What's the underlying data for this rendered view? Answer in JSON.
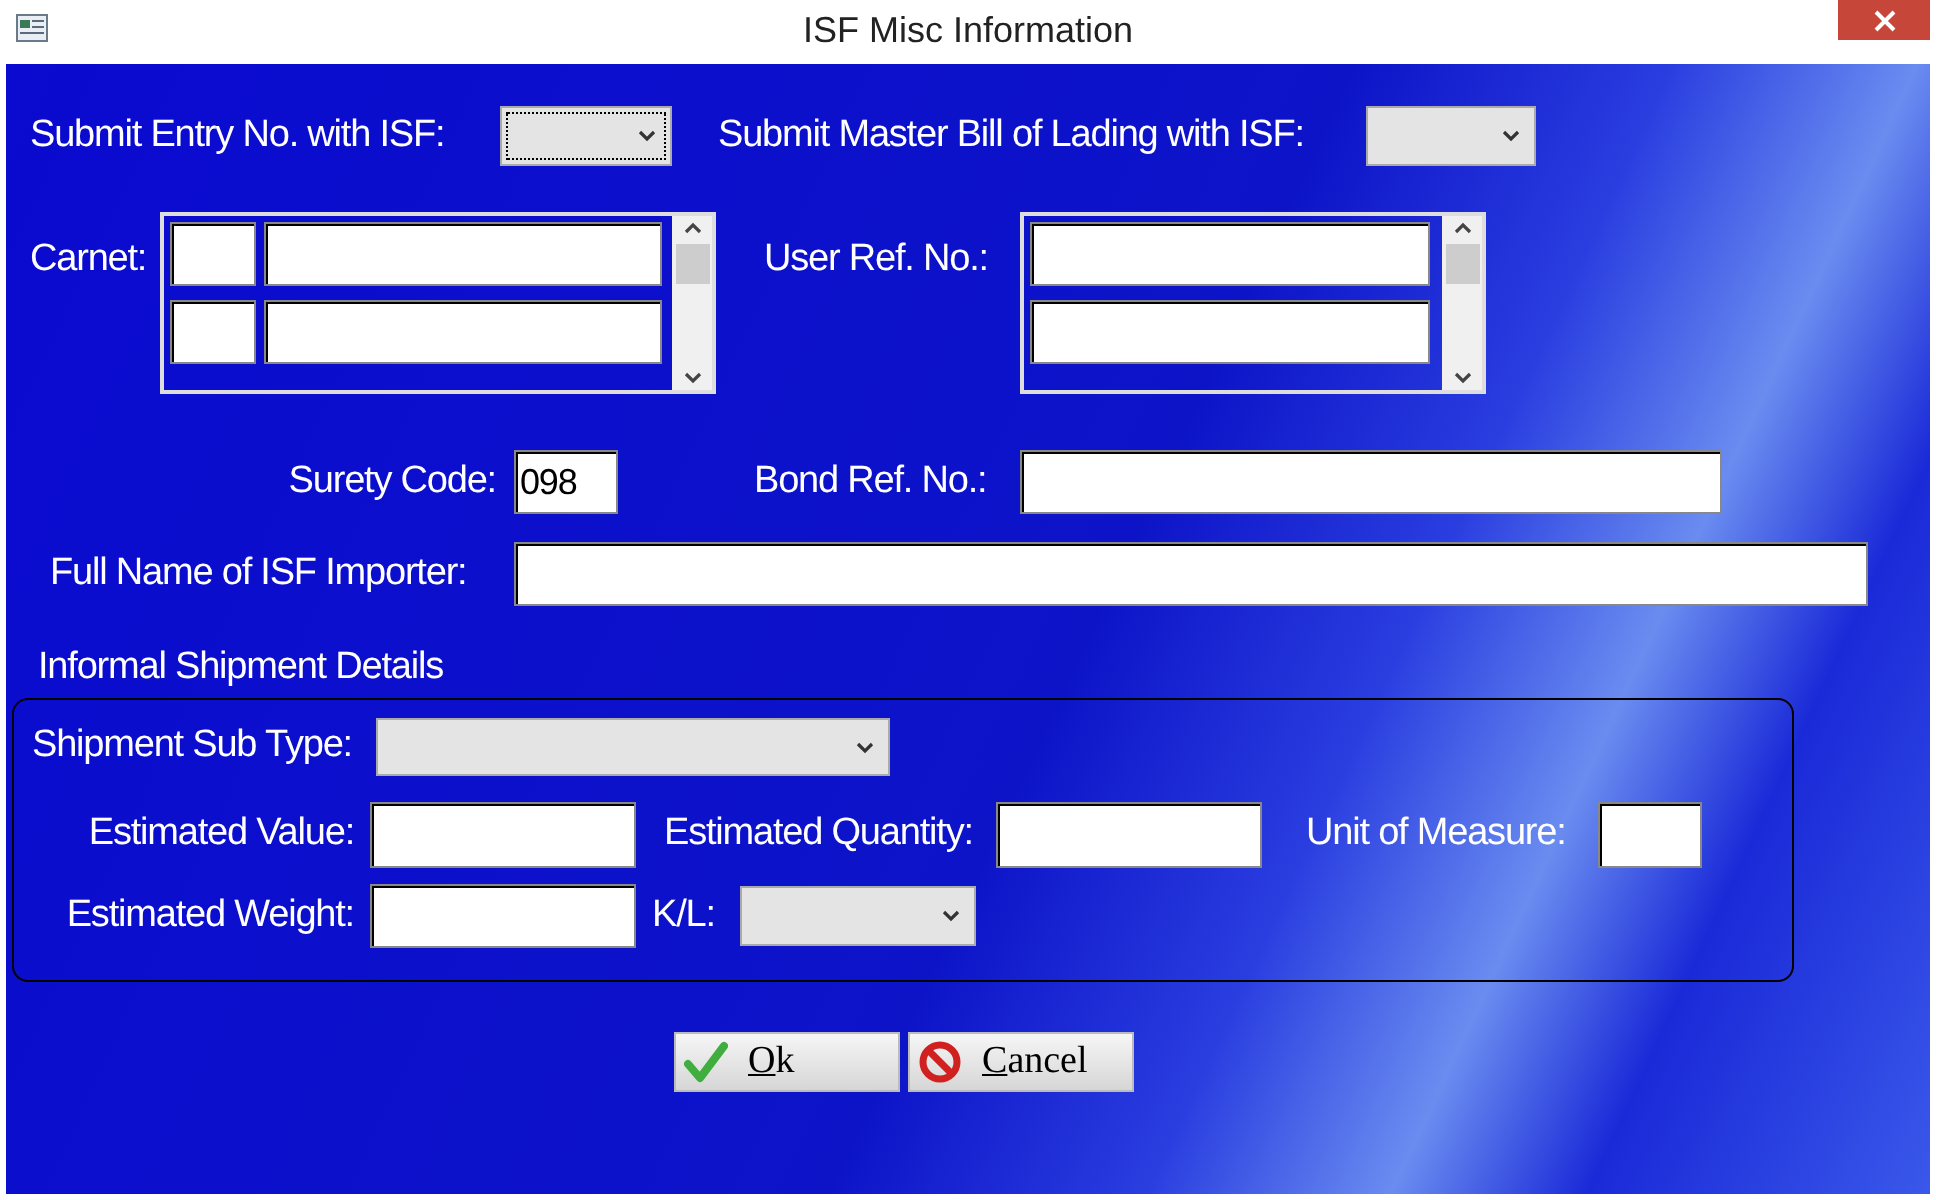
{
  "window": {
    "title": "ISF Misc Information"
  },
  "submit_entry": {
    "label": "Submit Entry No. with ISF:"
  },
  "submit_master_bill": {
    "label": "Submit Master Bill of Lading with ISF:"
  },
  "carnet": {
    "label": "Carnet:"
  },
  "user_ref": {
    "label": "User Ref. No.:"
  },
  "surety_code": {
    "label": "Surety Code:",
    "value": "098"
  },
  "bond_ref": {
    "label": "Bond Ref. No.:"
  },
  "importer_name": {
    "label": "Full Name of ISF Importer:"
  },
  "informal": {
    "title": "Informal Shipment Details",
    "shipment_sub_type": {
      "label": "Shipment Sub Type:"
    },
    "estimated_value": {
      "label": "Estimated Value:"
    },
    "estimated_quantity": {
      "label": "Estimated Quantity:"
    },
    "unit_of_measure": {
      "label": "Unit of Measure:"
    },
    "estimated_weight": {
      "label": "Estimated Weight:"
    },
    "kl": {
      "label": "K/L:"
    }
  },
  "buttons": [
    {
      "label": "Ok",
      "kind": "ok"
    },
    {
      "label": "Cancel",
      "kind": "cancel"
    }
  ]
}
